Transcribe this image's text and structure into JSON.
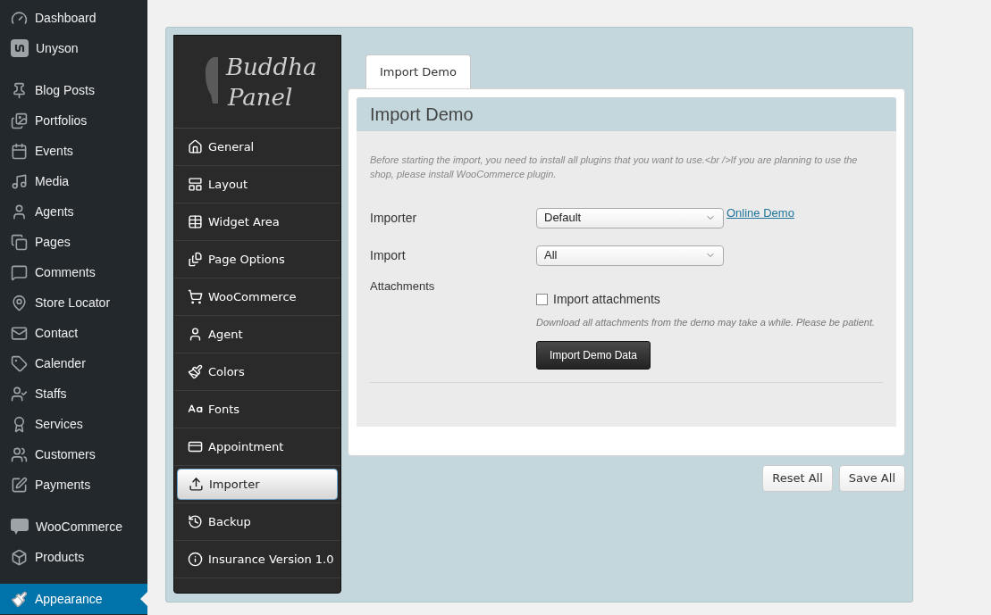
{
  "admin_menu": {
    "groups": [
      {
        "items": [
          {
            "label": "Dashboard",
            "selected": false
          },
          {
            "label": "Unyson",
            "selected": false
          }
        ]
      },
      {
        "items": [
          {
            "label": "Blog Posts",
            "selected": false
          },
          {
            "label": "Portfolios",
            "selected": false
          },
          {
            "label": "Events",
            "selected": false
          },
          {
            "label": "Media",
            "selected": false
          },
          {
            "label": "Agents",
            "selected": false
          },
          {
            "label": "Pages",
            "selected": false
          },
          {
            "label": "Comments",
            "selected": false
          },
          {
            "label": "Store Locator",
            "selected": false
          },
          {
            "label": "Contact",
            "selected": false
          },
          {
            "label": "Calender",
            "selected": false
          },
          {
            "label": "Staffs",
            "selected": false
          },
          {
            "label": "Services",
            "selected": false
          },
          {
            "label": "Customers",
            "selected": false
          },
          {
            "label": "Payments",
            "selected": false
          }
        ]
      },
      {
        "items": [
          {
            "label": "WooCommerce",
            "selected": false
          },
          {
            "label": "Products",
            "selected": false
          }
        ]
      },
      {
        "items": [
          {
            "label": "Appearance",
            "selected": true
          }
        ]
      }
    ]
  },
  "panel": {
    "logo": {
      "line_1": "Buddha",
      "line_2": "Panel"
    },
    "nav": [
      {
        "label": "General",
        "selected": false
      },
      {
        "label": "Layout",
        "selected": false
      },
      {
        "label": "Widget Area",
        "selected": false
      },
      {
        "label": "Page Options",
        "selected": false
      },
      {
        "label": "WooCommerce",
        "selected": false
      },
      {
        "label": "Agent",
        "selected": false
      },
      {
        "label": "Colors",
        "selected": false
      },
      {
        "label": "Fonts",
        "selected": false
      },
      {
        "label": "Appointment",
        "selected": false
      },
      {
        "label": "Importer",
        "selected": true
      },
      {
        "label": "Backup",
        "selected": false
      },
      {
        "label": "Insurance Version 1.0",
        "selected": false
      }
    ],
    "tab": {
      "label": "Import Demo",
      "selected": true
    },
    "section_title": "Import Demo",
    "notice": "Before starting the import, you need to install all plugins that you want to use.<br />If you are planning to use the shop, please install WooCommerce plugin.",
    "fields": [
      {
        "kind": "select",
        "label": "Importer",
        "value": "Default",
        "link": "Online Demo"
      },
      {
        "kind": "select",
        "label": "Import",
        "value": "All"
      },
      {
        "kind": "checkbox",
        "label": "Attachments",
        "option": "Import attachments",
        "checked": false,
        "help": "Download all attachments from the demo may take a while. Please be patient.",
        "button": "Import Demo Data"
      }
    ],
    "buttons": [
      "Reset All",
      "Save All"
    ]
  }
}
